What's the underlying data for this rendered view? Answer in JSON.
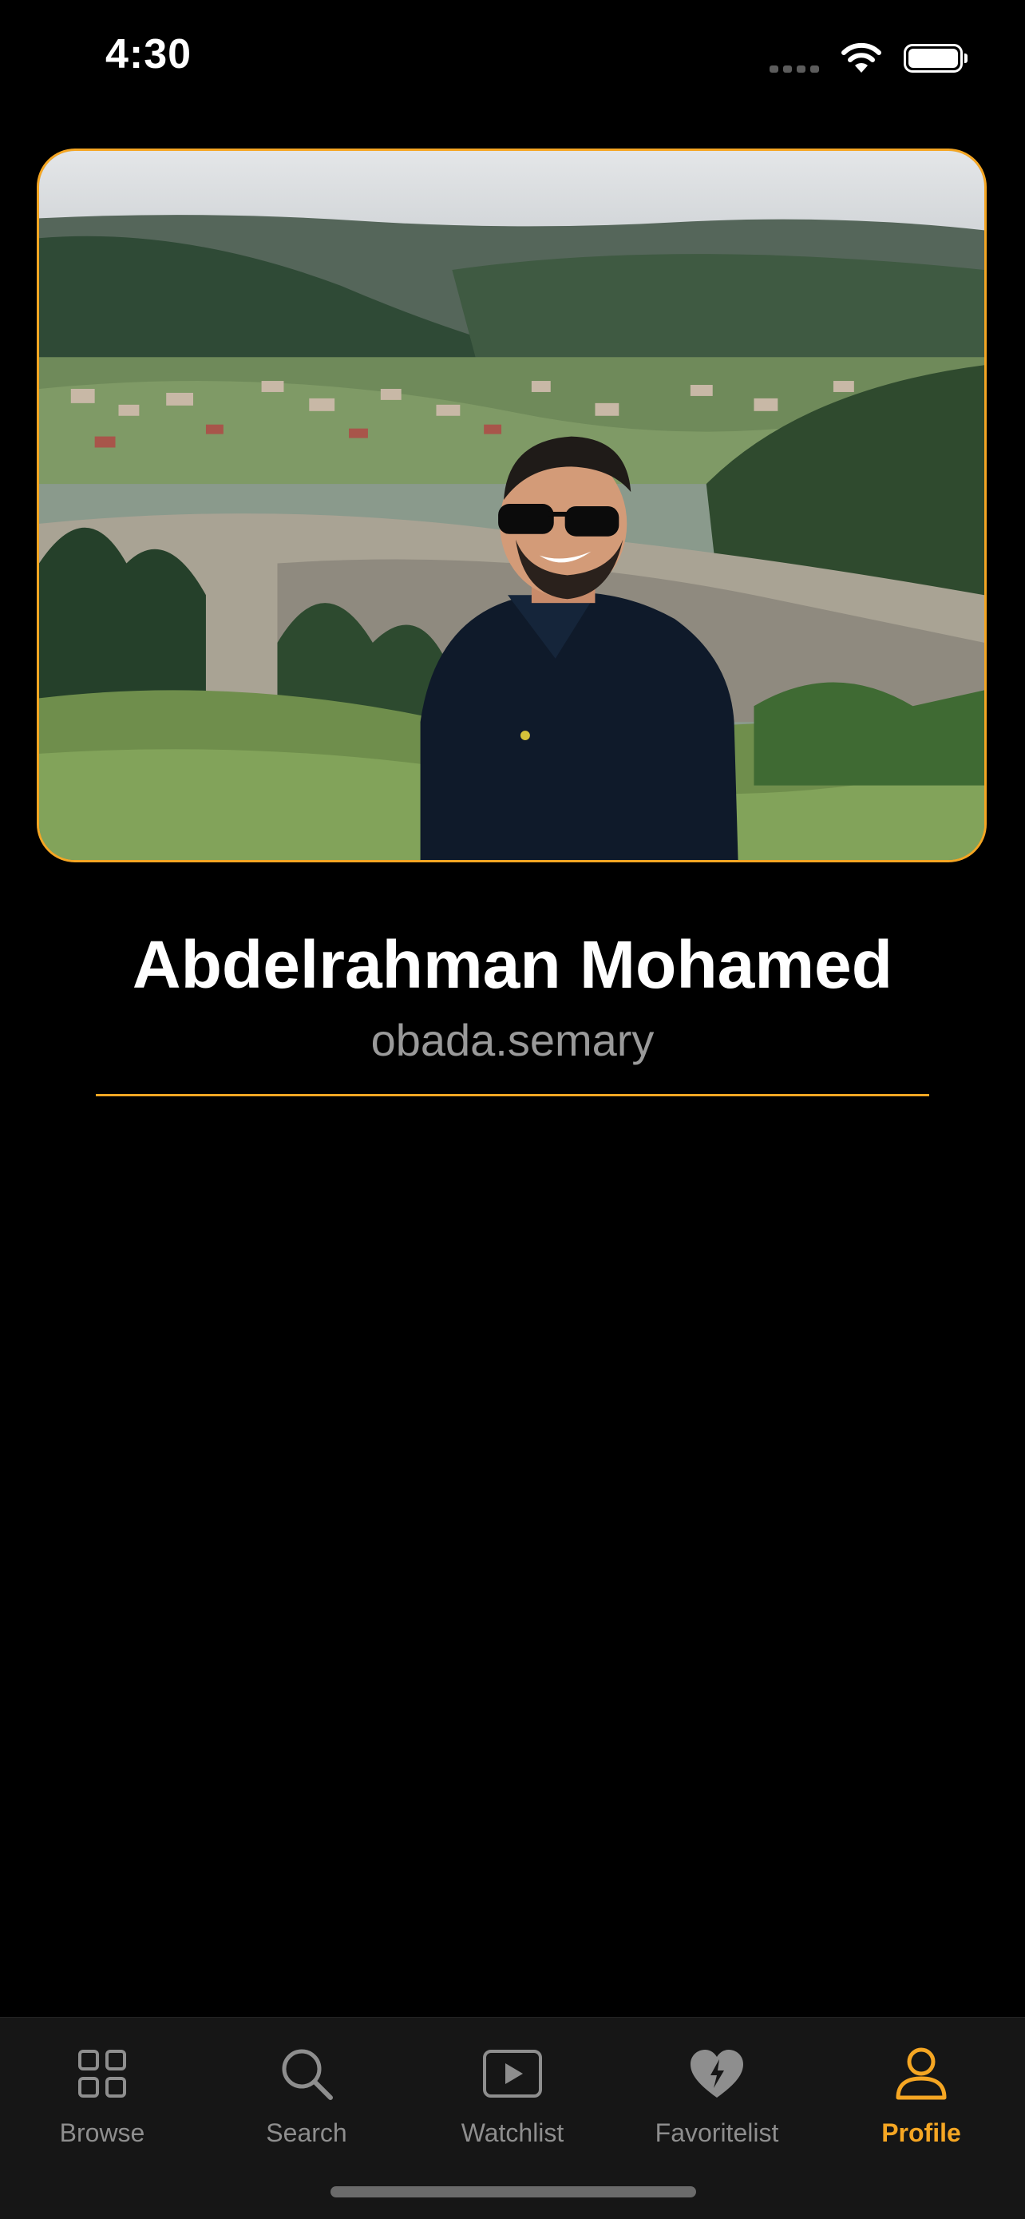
{
  "status_bar": {
    "time": "4:30"
  },
  "profile": {
    "name": "Abdelrahman Mohamed",
    "username": "obada.semary",
    "photo_icon": "profile-photo"
  },
  "colors": {
    "accent": "#f5a623",
    "background": "#000000",
    "tab_bar_background": "#161616",
    "inactive": "#8e8e8e",
    "username_text": "#9a9a9a"
  },
  "tab_bar": {
    "items": [
      {
        "label": "Browse",
        "icon": "grid-icon",
        "active": false
      },
      {
        "label": "Search",
        "icon": "search-icon",
        "active": false
      },
      {
        "label": "Watchlist",
        "icon": "play-icon",
        "active": false
      },
      {
        "label": "Favoritelist",
        "icon": "heart-bolt-icon",
        "active": false
      },
      {
        "label": "Profile",
        "icon": "person-icon",
        "active": true
      }
    ]
  }
}
